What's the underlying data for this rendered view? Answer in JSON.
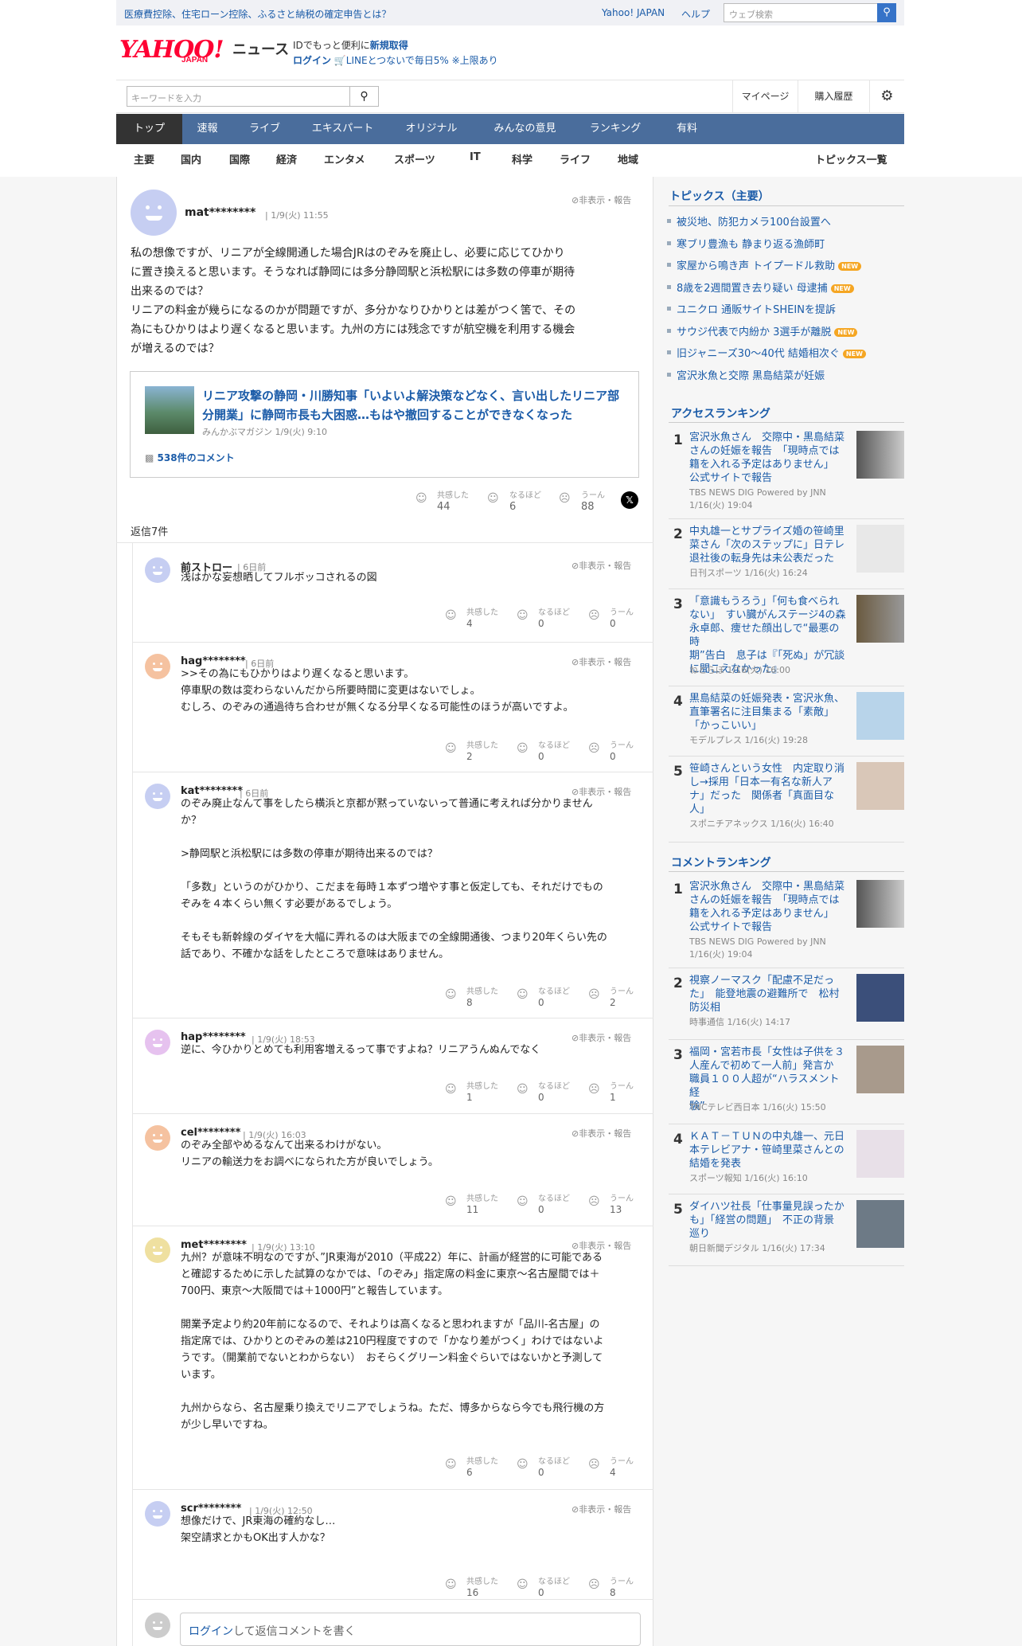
{
  "topbar": {
    "left_link": "医療費控除、住宅ローン控除、ふるさと納税の確定申告とは？",
    "yahoo_japan": "Yahoo! JAPAN",
    "help": "ヘルプ",
    "web_search_placeholder": "ウェブ検索"
  },
  "logo": {
    "text": "YAHOO!",
    "sub": "JAPAN",
    "news": "ニュース"
  },
  "promo": {
    "line1a": "IDでもっと便利に",
    "line1b": "新規取得",
    "line2a": "ログイン",
    "line2b": "LINEとつないで毎日5% ※上限あり"
  },
  "search": {
    "placeholder": "キーワードを入力",
    "mypage": "マイページ",
    "history": "購入履歴"
  },
  "nav": [
    "トップ",
    "速報",
    "ライブ",
    "エキスパート",
    "オリジナル",
    "みんなの意見",
    "ランキング",
    "有料"
  ],
  "subnav": [
    "主要",
    "国内",
    "国際",
    "経済",
    "エンタメ",
    "スポーツ",
    "IT",
    "科学",
    "ライフ",
    "地域"
  ],
  "subnav_all": "トピックス一覧",
  "main_comment": {
    "user": "mat********",
    "date": "1/9(火) 11:55",
    "report": "非表示・報告",
    "lines": [
      "私の想像ですが、リニアが全線開通した場合JRはのぞみを廃止し、必要に応じてひかり",
      "に置き換えると思います。そうなれば静岡には多分静岡駅と浜松駅には多数の停車が期待",
      "出来るのでは？",
      "リニアの料金が幾らになるのかが問題ですが、多分かなりひかりとは差がつく筈で、その",
      "為にもひかりはより遅くなると思います。九州の方には残念ですが航空機を利用する機会",
      "が増えるのでは？"
    ],
    "reactions": {
      "agree_label": "共感した",
      "agree": "44",
      "naruhodo_label": "なるほど",
      "naruhodo": "6",
      "uun_label": "うーん",
      "uun": "88"
    }
  },
  "article_card": {
    "title_l1": "リニア攻撃の静岡・川勝知事「いよいよ解決策などなく、言い出したリニア部",
    "title_l2": "分開業」に静岡市長も大困惑…もはや撤回することができなくなった",
    "meta": "みんかぶマガジン 1/9(火) 9:10",
    "comments": "538件のコメント"
  },
  "reply_count": "返信7件",
  "replies": [
    {
      "user": "前ストロー",
      "date": "6日前",
      "report": "非表示・報告",
      "lines": [
        "浅はかな妄想晒してフルボッコされるの図"
      ],
      "agree": "4",
      "naruhodo": "0",
      "uun": "0"
    },
    {
      "user": "hag********",
      "date": "6日前",
      "report": "非表示・報告",
      "lines": [
        ">>その為にもひかりはより遅くなると思います。",
        "停車駅の数は変わらないんだから所要時間に変更はないでしょ。",
        "むしろ、のぞみの通過待ち合わせが無くなる分早くなる可能性のほうが高いですよ。"
      ],
      "agree": "2",
      "naruhodo": "0",
      "uun": "0"
    },
    {
      "user": "kat********",
      "date": "6日前",
      "report": "非表示・報告",
      "lines": [
        "のぞみ廃止なんて事をしたら横浜と京都が黙っていないって普通に考えれば分かりません",
        "か？",
        "",
        ">静岡駅と浜松駅には多数の停車が期待出来るのでは？",
        "",
        "「多数」というのがひかり、こだまを毎時１本ずつ増やす事と仮定しても、それだけでもの",
        "ぞみを４本くらい無くす必要があるでしょう。",
        "",
        "そもそも新幹線のダイヤを大幅に弄れるのは大阪までの全線開通後、つまり20年くらい先の",
        "話であり、不確かな話をしたところで意味はありません。"
      ],
      "agree": "8",
      "naruhodo": "0",
      "uun": "2"
    },
    {
      "user": "hap********",
      "date": "1/9(火) 18:53",
      "report": "非表示・報告",
      "lines": [
        "逆に、今ひかりとめても利用客増えるって事ですよね？リニアうんぬんでなく"
      ],
      "agree": "1",
      "naruhodo": "0",
      "uun": "1"
    },
    {
      "user": "cel********",
      "date": "1/9(火) 16:03",
      "report": "非表示・報告",
      "lines": [
        "のぞみ全部やめるなんて出来るわけがない。",
        "リニアの輸送力をお調べになられた方が良いでしょう。"
      ],
      "agree": "11",
      "naruhodo": "0",
      "uun": "13"
    },
    {
      "user": "met********",
      "date": "1/9(火) 13:10",
      "report": "非表示・報告",
      "lines": [
        "九州？が意味不明なのですが、”JR東海が2010（平成22）年に、計画が経営的に可能である",
        "と確認するために示した試算のなかでは、「のぞみ」指定席の料金に東京〜名古屋間では＋",
        "700円、東京〜大阪間では＋1000円”と報告しています。",
        "",
        "開業予定より約20年前になるので、それよりは高くなると思われますが「品川-名古屋」の",
        "指定席では、ひかりとのぞみの差は210円程度ですので「かなり差がつく」わけではないよ",
        "うです。（開業前でないとわからない）　おそらくグリーン料金ぐらいではないかと予測して",
        "います。",
        "",
        "九州からなら、名古屋乗り換えでリニアでしょうね。ただ、博多からなら今でも飛行機の方",
        "が少し早いですね。"
      ],
      "agree": "6",
      "naruhodo": "0",
      "uun": "4"
    },
    {
      "user": "scr********",
      "date": "1/9(火) 12:50",
      "report": "非表示・報告",
      "lines": [
        "想像だけで、JR東海の確約なし…",
        "架空請求とかもOK出す人かな？"
      ],
      "agree": "16",
      "naruhodo": "0",
      "uun": "8"
    }
  ],
  "reply_input": {
    "login": "ログイン",
    "text": "して返信コメントを書く"
  },
  "topics": {
    "title": "トピックス（主要）",
    "new_label": "NEW",
    "items": [
      {
        "text": "被災地、防犯カメラ100台設置へ",
        "new": false
      },
      {
        "text": "寒ブリ豊漁も 静まり返る漁師町",
        "new": false
      },
      {
        "text": "家屋から鳴き声 トイプードル救助",
        "new": true
      },
      {
        "text": "8歳を2週間置き去り疑い 母逮捕",
        "new": true
      },
      {
        "text": "ユニクロ 通販サイトSHEINを提訴",
        "new": false
      },
      {
        "text": "サウジ代表で内紛か 3選手が離脱",
        "new": true
      },
      {
        "text": "旧ジャニーズ30〜40代 結婚相次ぐ",
        "new": true
      },
      {
        "text": "宮沢氷魚と交際 黒島結菜が妊娠",
        "new": false
      }
    ]
  },
  "access_ranking": {
    "title": "アクセスランキング",
    "items": [
      {
        "rank": "1",
        "lines": [
          "宮沢氷魚さん　交際中・黒島結菜",
          "さんの妊娠を報告　「現時点では",
          "籍を入れる予定はありません」",
          "公式サイトで報告"
        ],
        "source": "TBS NEWS DIG Powered by JNN",
        "date": "1/16(火) 19:04"
      },
      {
        "rank": "2",
        "lines": [
          "中丸雄一とサプライズ婚の笹崎里",
          "菜さん「次のステップに」日テレ",
          "退社後の転身先は未公表だった"
        ],
        "source": "日刊スポーツ",
        "date": "1/16(火) 16:24"
      },
      {
        "rank": "3",
        "lines": [
          "「意識もうろう」「何も食べられ",
          "ない」　すい臓がんステージ4の森",
          "永卓郎、痩せた顔出しで“最悪の時",
          "期”告白　息子は『「死ぬ」が冗談",
          "に聞こえなかった』"
        ],
        "source": "ねとらぼ",
        "date": "1/16(火) 16:00"
      },
      {
        "rank": "4",
        "lines": [
          "黒島結菜の妊娠発表・宮沢氷魚、",
          "直筆署名に注目集まる「素敵」",
          "「かっこいい」"
        ],
        "source": "モデルプレス",
        "date": "1/16(火) 19:28"
      },
      {
        "rank": "5",
        "lines": [
          "笹崎さんという女性　内定取り消",
          "し→採用「日本一有名な新人ア",
          "ナ」だった　関係者「真面目な",
          "人」"
        ],
        "source": "スポニチアネックス",
        "date": "1/16(火) 16:40"
      }
    ]
  },
  "comment_ranking": {
    "title": "コメントランキング",
    "items": [
      {
        "rank": "1",
        "lines": [
          "宮沢氷魚さん　交際中・黒島結菜",
          "さんの妊娠を報告　「現時点では",
          "籍を入れる予定はありません」",
          "公式サイトで報告"
        ],
        "source": "TBS NEWS DIG Powered by JNN",
        "date": "1/16(火) 19:04"
      },
      {
        "rank": "2",
        "lines": [
          "視察ノーマスク「配慮不足だっ",
          "た」　能登地震の避難所で　松村",
          "防災相"
        ],
        "source": "時事通信",
        "date": "1/16(火) 14:17"
      },
      {
        "rank": "3",
        "lines": [
          "福岡・宮若市長「女性は子供を３",
          "人産んで初めて一人前」発言か",
          "職員１００人超が“ハラスメント経",
          "験”"
        ],
        "source": "TNCテレビ西日本",
        "date": "1/16(火) 15:50"
      },
      {
        "rank": "4",
        "lines": [
          "ＫＡＴ－ＴＵＮの中丸雄一、元日",
          "本テレビアナ・笹崎里菜さんとの",
          "結婚を発表"
        ],
        "source": "スポーツ報知",
        "date": "1/16(火) 16:10"
      },
      {
        "rank": "5",
        "lines": [
          "ダイハツ社長「仕事量見誤ったか",
          "も」「経営の問題」　不正の背景",
          "巡り"
        ],
        "source": "朝日新聞デジタル",
        "date": "1/16(火) 17:34"
      }
    ]
  },
  "colors": {
    "link": "#1a5ba8",
    "nav": "#4a6d9c",
    "brand": "#ff0033"
  }
}
